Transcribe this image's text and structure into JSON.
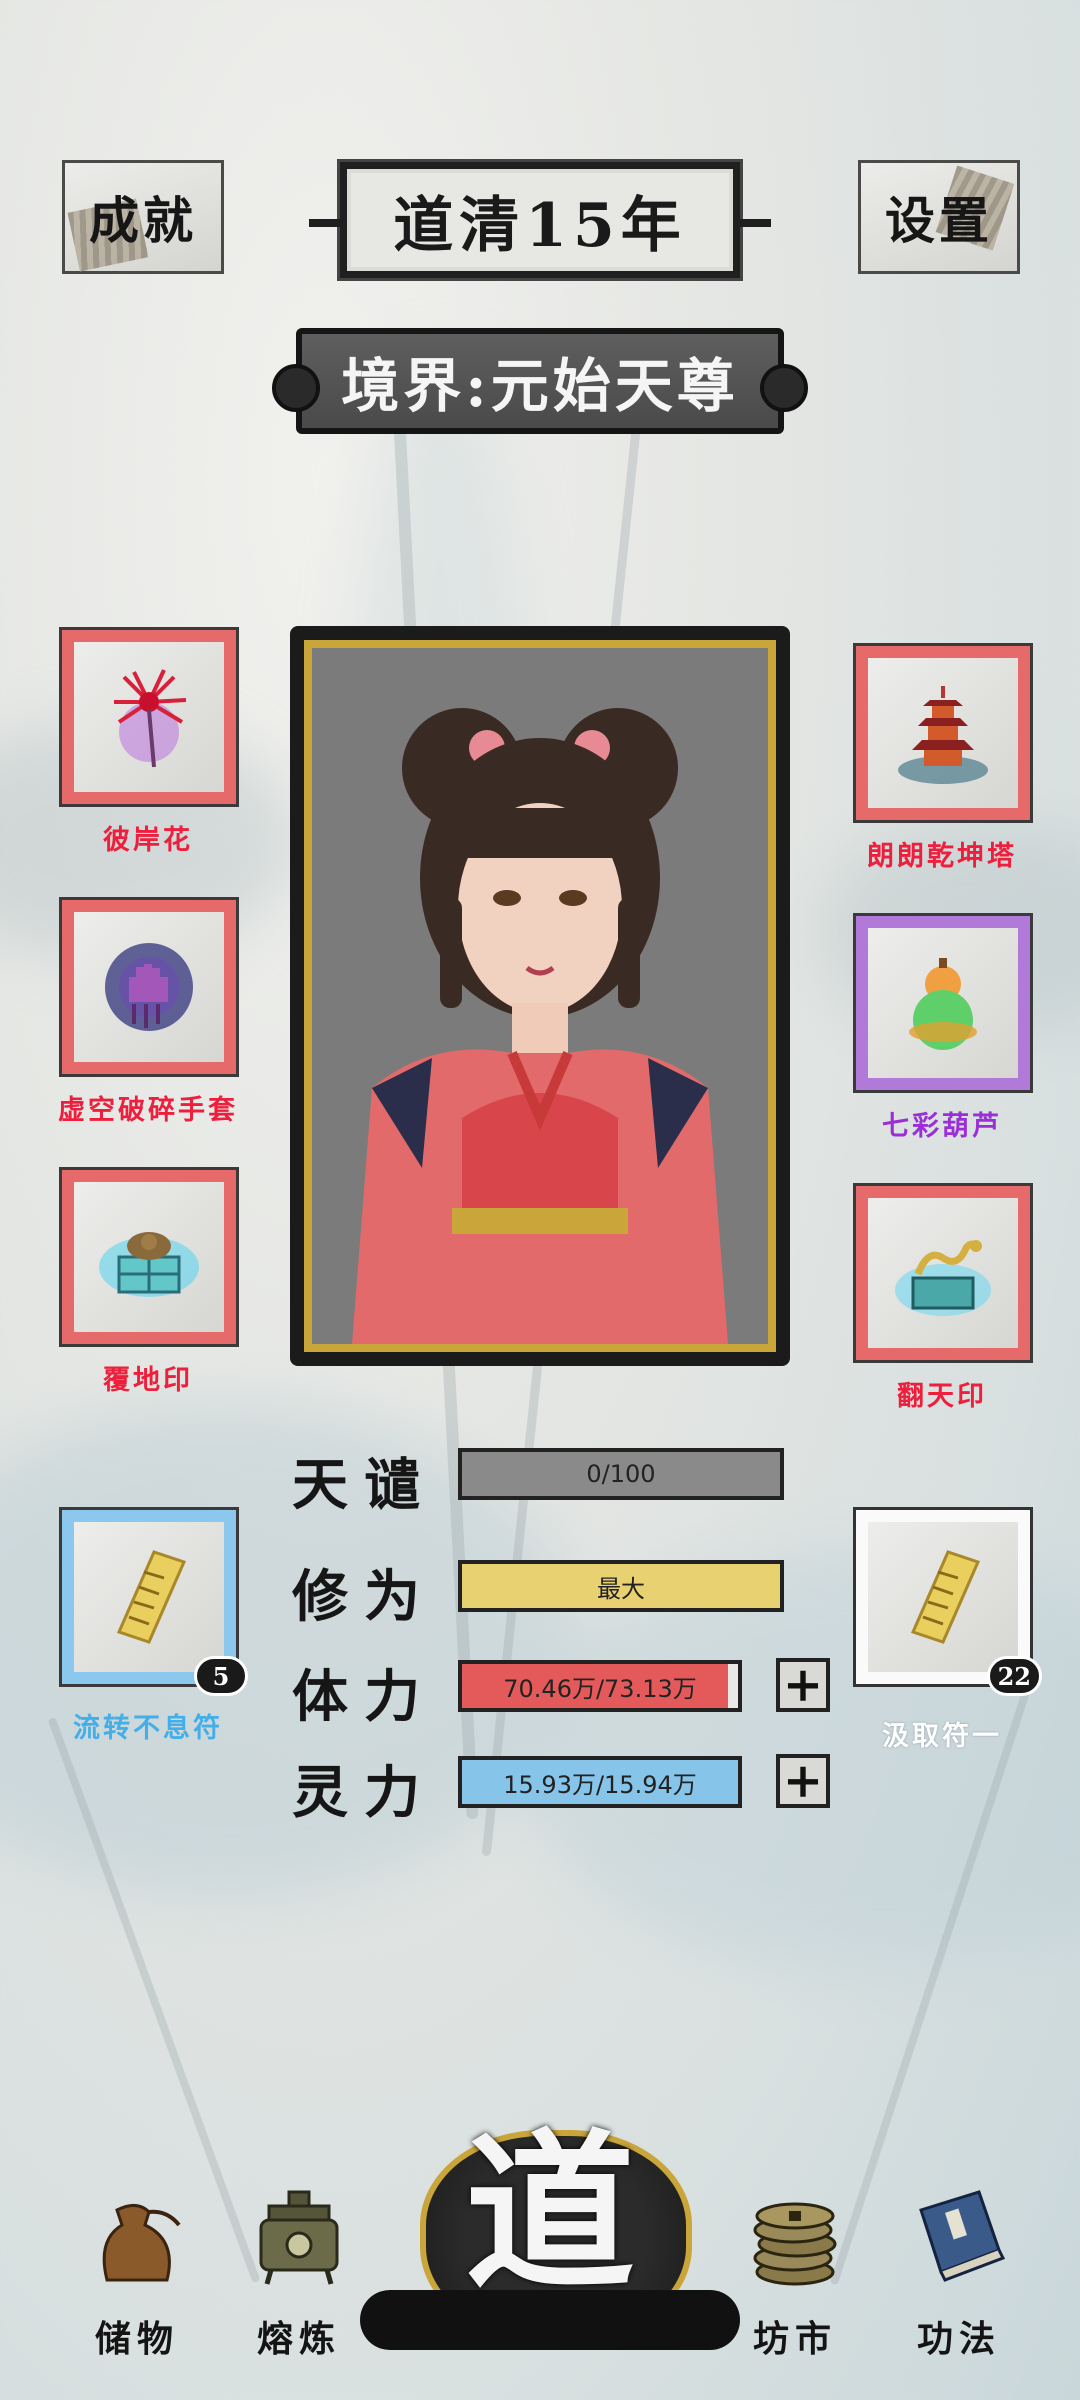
{
  "header": {
    "achievements_label": "成就",
    "year_title": "道清15年",
    "settings_label": "设置",
    "realm_label": "境界:元始天尊"
  },
  "left_items": [
    {
      "label": "彼岸花",
      "icon": "red-spider-lily-icon",
      "rarity": "red"
    },
    {
      "label": "虚空破碎手套",
      "icon": "void-glove-icon",
      "rarity": "red"
    },
    {
      "label": "覆地印",
      "icon": "earth-seal-icon",
      "rarity": "red"
    }
  ],
  "right_items": [
    {
      "label": "朗朗乾坤塔",
      "icon": "pagoda-icon",
      "rarity": "red"
    },
    {
      "label": "七彩葫芦",
      "icon": "gourd-icon",
      "rarity": "purple"
    },
    {
      "label": "翻天印",
      "icon": "dragon-seal-icon",
      "rarity": "red"
    }
  ],
  "talismans": [
    {
      "label": "流转不息符",
      "count": "5",
      "icon": "talisman-icon",
      "rarity": "blue"
    },
    {
      "label": "汲取符一",
      "count": "22",
      "icon": "talisman-icon",
      "rarity": "white"
    }
  ],
  "stats": {
    "tribulation": {
      "label": "天谴",
      "value": "0/100",
      "fraction": 0.0
    },
    "cultivation": {
      "label": "修为",
      "value": "最大",
      "fraction": 1.0
    },
    "stamina": {
      "label": "体力",
      "value": "70.46万/73.13万",
      "fraction": 0.963
    },
    "spirit": {
      "label": "灵力",
      "value": "15.93万/15.94万",
      "fraction": 0.999
    }
  },
  "colors": {
    "rarity_red": "#e76a6a",
    "rarity_purple": "#b27ad8",
    "rarity_blue": "#8cc8ee",
    "gold": "#c9a53a",
    "cultivation_bar": "#e8d170",
    "stamina_bar": "#e45a5a",
    "spirit_bar": "#86c4ea"
  },
  "nav": {
    "storage": "储物",
    "refine": "熔炼",
    "dao": "道",
    "market": "坊市",
    "techniques": "功法"
  }
}
